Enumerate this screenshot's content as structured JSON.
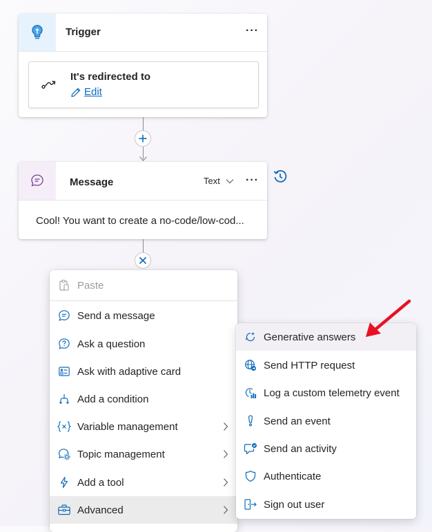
{
  "trigger": {
    "title": "Trigger",
    "more": "···",
    "inner_title": "It's redirected to",
    "edit_label": "Edit"
  },
  "message": {
    "title": "Message",
    "type_label": "Text",
    "more": "···",
    "body": "Cool! You want to create a no-code/low-cod..."
  },
  "menu": {
    "paste": "Paste",
    "items": [
      {
        "label": "Send a message",
        "icon": "chat-bubble-icon"
      },
      {
        "label": "Ask a question",
        "icon": "question-bubble-icon"
      },
      {
        "label": "Ask with adaptive card",
        "icon": "adaptive-card-icon"
      },
      {
        "label": "Add a condition",
        "icon": "branch-icon"
      },
      {
        "label": "Variable management",
        "icon": "variable-icon",
        "has_submenu": true
      },
      {
        "label": "Topic management",
        "icon": "topic-settings-icon",
        "has_submenu": true
      },
      {
        "label": "Add a tool",
        "icon": "lightning-icon",
        "has_submenu": true
      },
      {
        "label": "Advanced",
        "icon": "toolbox-icon",
        "has_submenu": true,
        "selected": true
      }
    ]
  },
  "submenu": {
    "items": [
      {
        "label": "Generative answers",
        "icon": "generative-answers-icon",
        "highlighted": true
      },
      {
        "label": "Send HTTP request",
        "icon": "globe-icon"
      },
      {
        "label": "Log a custom telemetry event",
        "icon": "telemetry-icon"
      },
      {
        "label": "Send an event",
        "icon": "event-icon"
      },
      {
        "label": "Send an activity",
        "icon": "activity-icon"
      },
      {
        "label": "Authenticate",
        "icon": "shield-icon"
      },
      {
        "label": "Sign out user",
        "icon": "sign-out-icon"
      }
    ]
  },
  "colors": {
    "accent": "#0f6cbd",
    "trigger_icon_bg": "#e6f3fc",
    "message_icon_bg": "#f5eef9",
    "arrow_red": "#e81123",
    "selected_bg": "#ebebeb",
    "highlight_bg": "#f3f0f5"
  }
}
